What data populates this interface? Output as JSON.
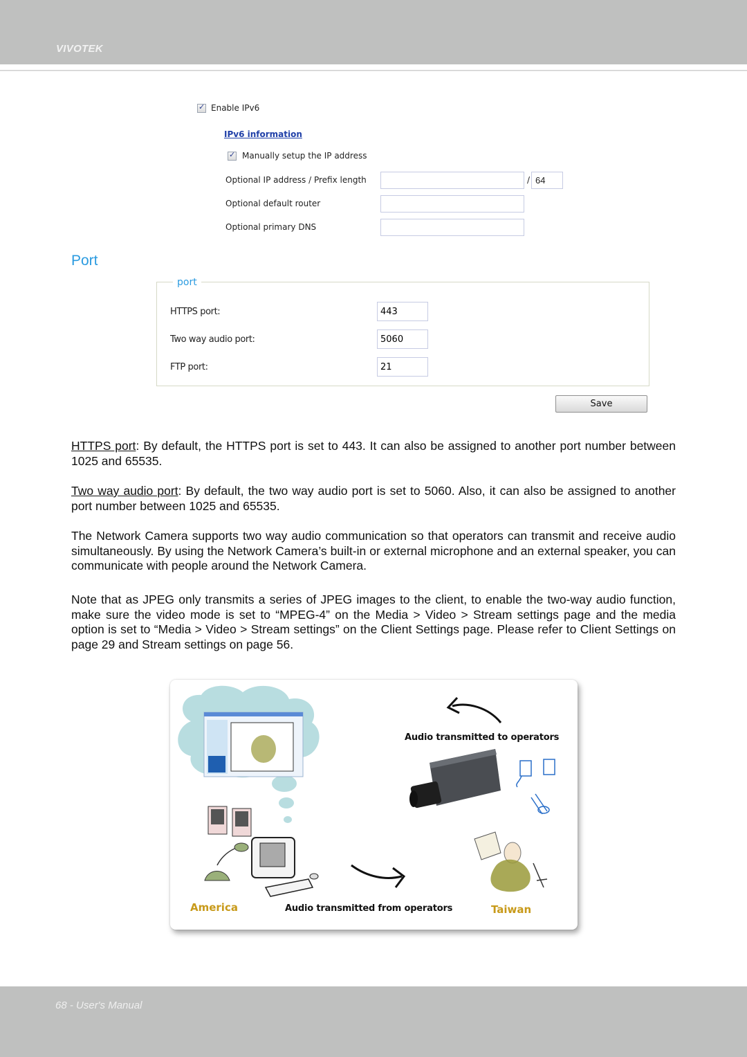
{
  "header": {
    "brand": "VIVOTEK"
  },
  "ipv6": {
    "enable_label": "Enable IPv6",
    "enable_checked": true,
    "info_link": "IPv6 information",
    "manual_label": "Manually setup the IP address",
    "manual_checked": true,
    "ip_label": "Optional IP address / Prefix length",
    "ip_value": "",
    "prefix_separator": "/",
    "prefix_value": "64",
    "router_label": "Optional default router",
    "router_value": "",
    "dns_label": "Optional primary DNS",
    "dns_value": ""
  },
  "port_section": {
    "title": "Port",
    "legend": "port",
    "fields": [
      {
        "label": "HTTPS port:",
        "value": "443"
      },
      {
        "label": "Two way audio port:",
        "value": "5060"
      },
      {
        "label": "FTP port:",
        "value": "21"
      }
    ],
    "save_label": "Save"
  },
  "body": {
    "p1_term": "HTTPS port",
    "p1_text": ": By default, the HTTPS port is set to 443. It can also be assigned to another port number between 1025 and 65535.",
    "p2_term": "Two way audio port",
    "p2_text": ": By default, the two way audio port is set to 5060. Also, it can also be assigned to another port number between 1025 and 65535.",
    "p3": "The Network Camera supports two way audio communication so that operators can transmit and receive audio simultaneously. By using the Network Camera’s built-in or external microphone and an external speaker, you can communicate with people around the Network Camera.",
    "p4": "Note that as JPEG only transmits a series of JPEG images to the client, to enable the two-way audio function, make sure the video mode is set to “MPEG-4” on the Media > Video > Stream settings page and the media option is set to “Media > Video > Stream settings” on the Client Settings page. Please refer to Client Settings on page 29 and Stream settings on page 56."
  },
  "figure": {
    "caption_to": "Audio transmitted to operators",
    "caption_from": "Audio transmitted from operators",
    "place_left": "America",
    "place_right": "Taiwan",
    "colors": {
      "place": "#c89a1a",
      "cloud": "#b8dde0",
      "doodle": "#2a6fc9"
    }
  },
  "footer": {
    "text": "68 - User's Manual"
  }
}
